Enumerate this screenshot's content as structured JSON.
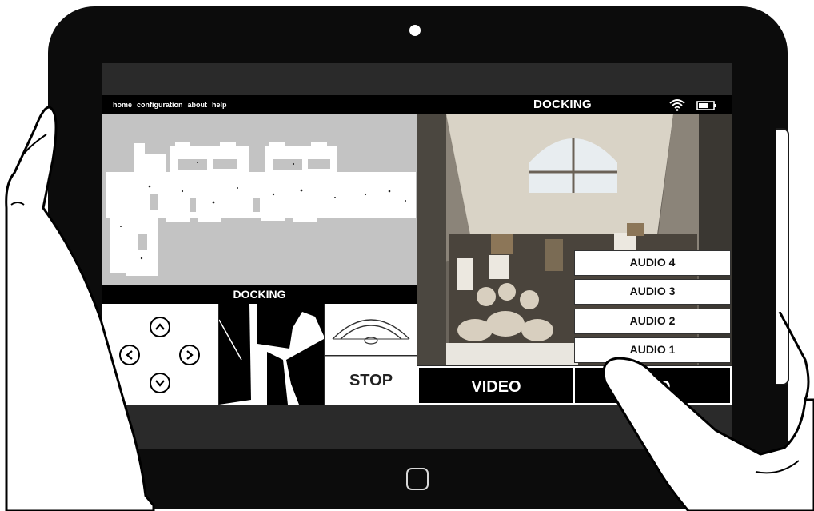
{
  "nav": {
    "links": [
      "home",
      "configuration",
      "about",
      "help"
    ],
    "title": "DOCKING"
  },
  "map": {
    "status_label": "DOCKING"
  },
  "controls": {
    "stop_label": "STOP"
  },
  "audio_menu": {
    "items": [
      "AUDIO 4",
      "AUDIO 3",
      "AUDIO 2",
      "AUDIO 1"
    ]
  },
  "tabs": {
    "video_label": "VIDEO",
    "audio_label": "AUDIO",
    "audio_visible_fragment": "O"
  },
  "icons": {
    "wifi": "wifi-icon",
    "battery": "battery-icon",
    "arrows": [
      "arrow-up-icon",
      "arrow-left-icon",
      "arrow-right-icon",
      "arrow-down-icon"
    ]
  },
  "colors": {
    "screen_bg": "#2a2a2a",
    "bar_bg": "#000000",
    "map_bg": "#c3c3c3",
    "text_light": "#ffffff"
  }
}
